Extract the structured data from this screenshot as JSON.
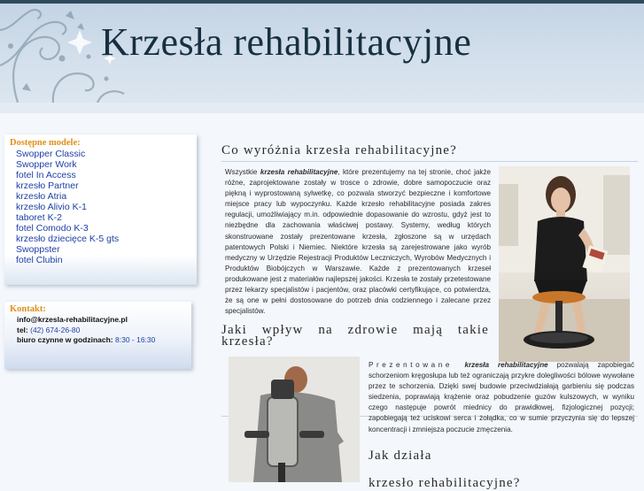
{
  "header": {
    "title": "Krzesła rehabilitacyjne"
  },
  "sidebar": {
    "models": {
      "title": "Dostępne modele:",
      "items": [
        {
          "label": "Swopper Classic"
        },
        {
          "label": "Swopper Work"
        },
        {
          "label": "fotel In Access"
        },
        {
          "label": "krzesło Partner"
        },
        {
          "label": "krzesło Atria"
        },
        {
          "label": "krzesło Alivio K-1"
        },
        {
          "label": "taboret K-2"
        },
        {
          "label": "fotel Comodo K-3"
        },
        {
          "label": "krzesło dziecięce K-5 gts"
        },
        {
          "label": "Swoppster"
        },
        {
          "label": "fotel Clubin"
        }
      ]
    },
    "contact": {
      "title": "Kontakt:",
      "email": "info@krzesla-rehabilitacyjne.pl",
      "tel_label": "tel:",
      "tel_value": "(42) 674-26-80",
      "hours_label": "biuro czynne w godzinach:",
      "hours_value": "8:30 - 16:30"
    }
  },
  "main": {
    "section1": {
      "heading": "Co wyróżnia krzesła rehabilitacyjne?",
      "lead_plain": "Wszystkie ",
      "lead_em": "krzesła rehabilitacyjne",
      "body": ", które prezentujemy na tej stronie, choć jakże różne, zaprojektowane zostały w trosce o zdrowie, dobre samopoczucie oraz piękną i wyprostowaną sylwetkę, co pozwala stworzyć bezpieczne i komfortowe miejsce pracy lub wypoczynku. Każde krzesło rehabilitacyjne posiada zakres regulacji, umożliwiający m.in. odpowiednie dopasowanie do wzrostu, gdyż jest to niezbędne dla zachowania właściwej postawy. Systemy, według których skonstruowane zostały prezentowane krzesła, zgłoszone są w urzędach patentowych Polski i Niemiec. Niektóre krzesła są zarejestrowane jako wyrób medyczny w Urzędzie Rejestracji Produktów Leczniczych, Wyrobów Medycznych i Produktów Biobójczych w Warszawie. Każde z prezentowanych krzeseł produkowane jest z materiałów najlepszej jakości. Krzesła te zostały przetestowane przez lekarzy specjalistów i pacjentów, oraz placówki certyfikujące, co potwierdza, że są one w pełni dostosowane do potrzeb dnia codziennego i zalecane przez specjalistów."
    },
    "section2": {
      "heading_line1": "Jaki wpływ na zdrowie mają takie",
      "heading_line2": "krzesła?",
      "lead_plain": "Prezentowane ",
      "lead_em": "krzesła rehabilitacyjne",
      "body": " pozwalają zapobiegać schorzeniom kręgosłupa lub też ograniczają przykre dolegliwości bólowe wywołane przez te schorzenia. Dzięki swej budowie przeciwdziałają garbieniu się podczas siedzenia, poprawiają krążenie oraz pobudzenie guzów kulszowych, w wyniku czego następuje powrót miednicy do prawidłowej, fizjologicznej pozycji; zapobiegają też uciskowi serca i żołądka, co w sumie przyczynia się do lepszej koncentracji i zmniejsza poczucie zmęczenia."
    },
    "section3": {
      "heading": "Jak działa",
      "cut_line": "krzesło rehabilitacyjne?"
    }
  },
  "images": {
    "woman": {
      "icon": "woman-on-swopper-photo"
    },
    "man": {
      "icon": "man-in-office-chair-photo"
    }
  },
  "colors": {
    "header_dark": "#2f4a5c",
    "title": "#16303f",
    "box_title": "#e0901a",
    "link": "#1d3fa6"
  }
}
